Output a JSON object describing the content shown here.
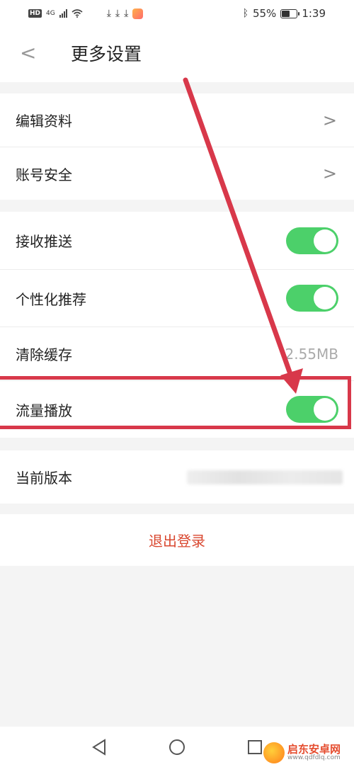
{
  "status_bar": {
    "hd": "HD",
    "network": "4G",
    "battery": "55%",
    "battery_level": 0.55,
    "time": "1:39"
  },
  "header": {
    "back_symbol": "<",
    "title": "更多设置"
  },
  "group1": [
    {
      "label": "编辑资料",
      "action": ">"
    },
    {
      "label": "账号安全",
      "action": ">"
    }
  ],
  "group2": {
    "push": {
      "label": "接收推送",
      "enabled": true
    },
    "personalized": {
      "label": "个性化推荐",
      "enabled": true
    },
    "cache": {
      "label": "清除缓存",
      "value": "2.55MB"
    },
    "data_play": {
      "label": "流量播放",
      "enabled": true
    }
  },
  "group3": {
    "version": {
      "label": "当前版本"
    }
  },
  "logout": {
    "label": "退出登录"
  },
  "colors": {
    "accent_green": "#4cd06a",
    "logout_red": "#d9472f",
    "annotation_red": "#d8384a"
  },
  "watermark": {
    "name": "启东安卓网",
    "url": "www.qdfdlq.com"
  }
}
